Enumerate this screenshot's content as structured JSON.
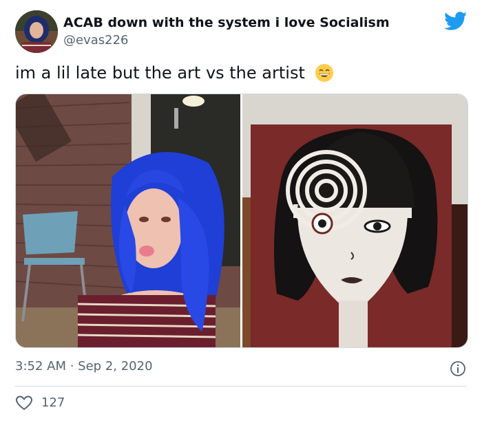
{
  "user": {
    "display_name": "ACAB down with the system i love Socialism",
    "handle": "@evas226"
  },
  "tweet": {
    "text": "im a lil late but the art vs the artist",
    "emoji": "grinning-face-with-smiling-eyes"
  },
  "media": {
    "left_photo": "photo of the artist",
    "right_photo": "painting of the artist"
  },
  "meta": {
    "time": "3:52 AM",
    "separator": " · ",
    "date": "Sep 2, 2020"
  },
  "stats": {
    "likes": "127"
  },
  "colors": {
    "twitter_blue": "#1d9bf0",
    "muted_text": "#536471",
    "border": "#cfd9de"
  }
}
